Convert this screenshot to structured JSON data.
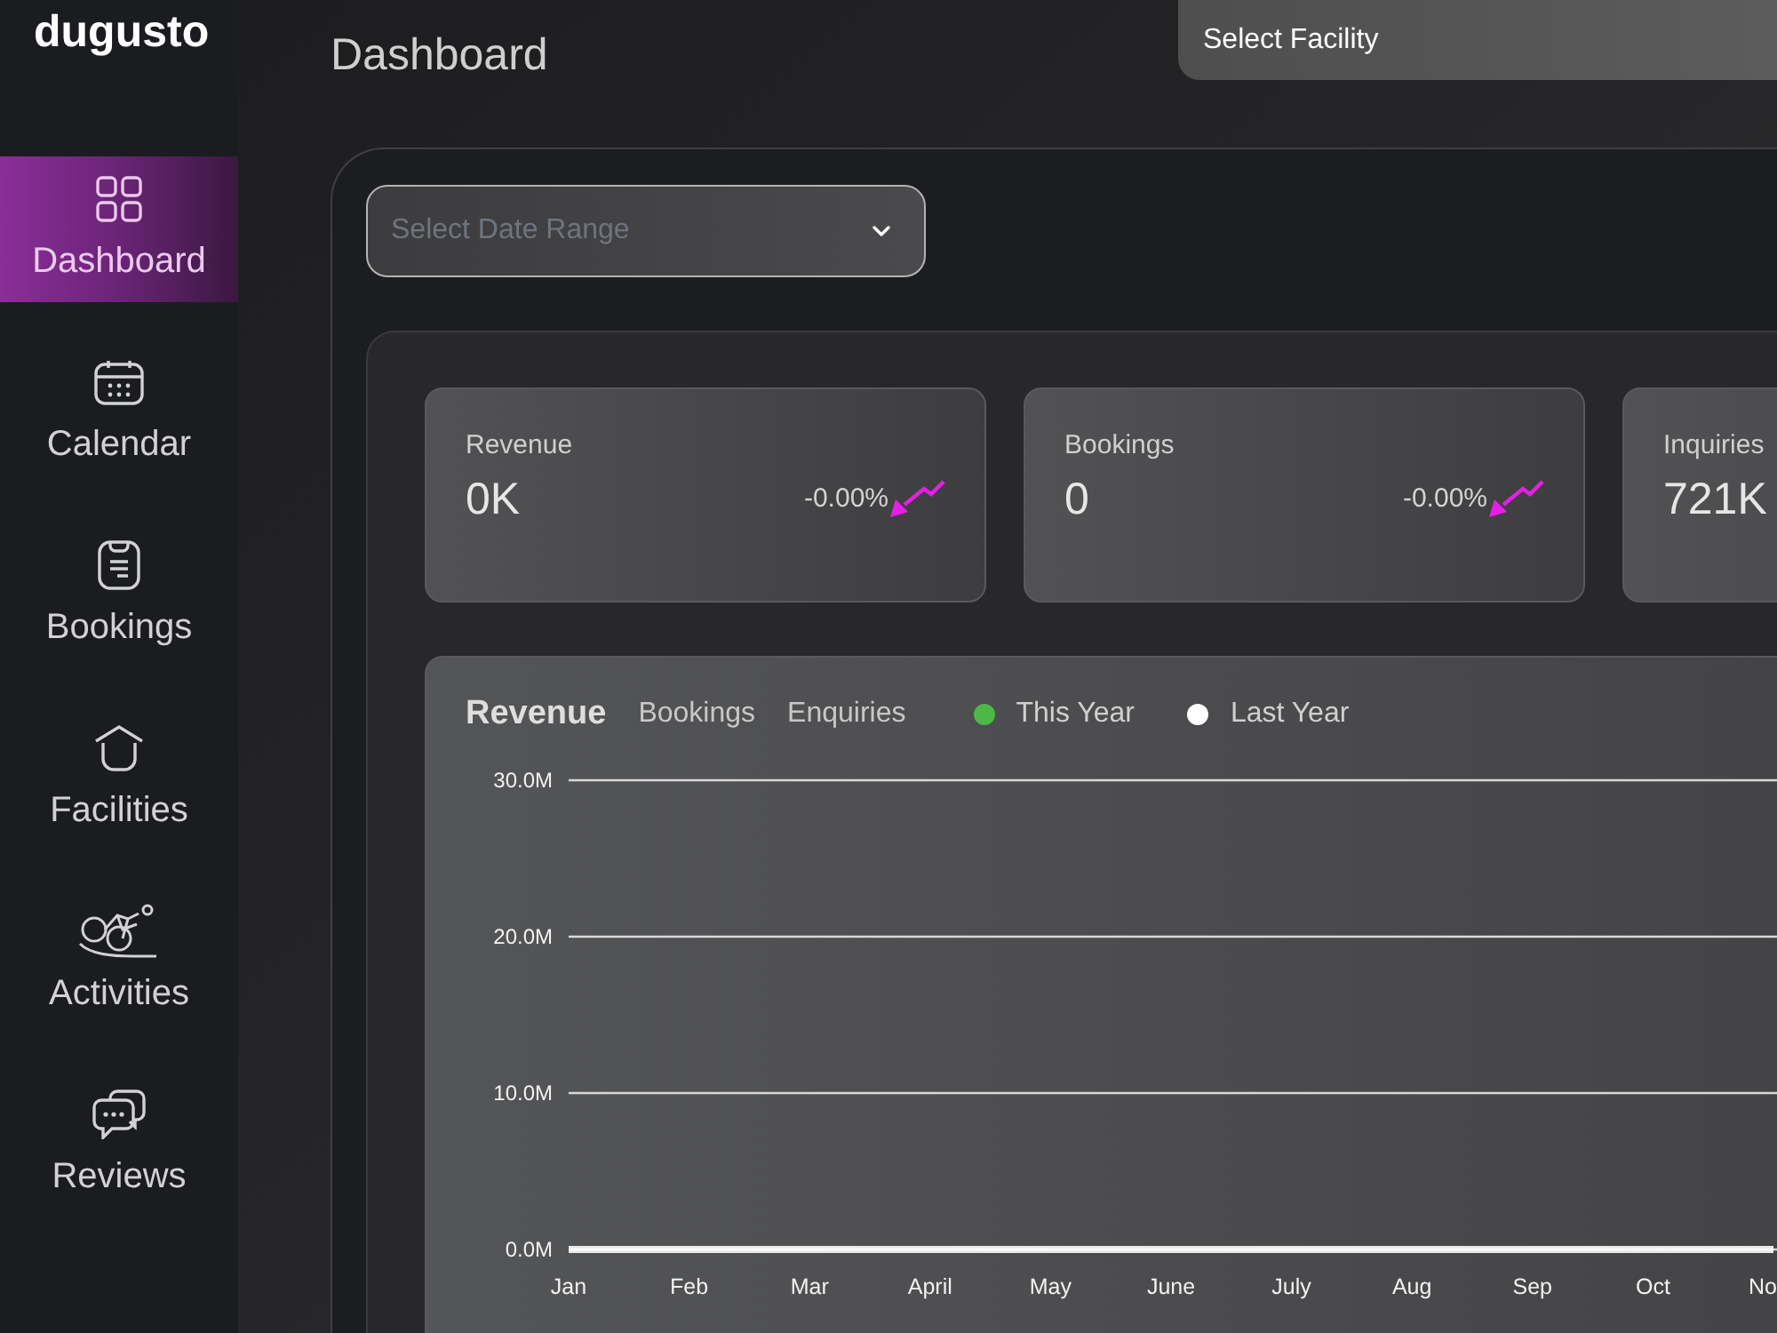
{
  "sidebar": {
    "logo": "dugusto",
    "items": [
      {
        "label": "Dashboard",
        "selected": true
      },
      {
        "label": "Calendar",
        "selected": false
      },
      {
        "label": "Bookings",
        "selected": false
      },
      {
        "label": "Facilities",
        "selected": false
      },
      {
        "label": "Activities",
        "selected": false
      },
      {
        "label": "Reviews",
        "selected": false
      }
    ]
  },
  "header": {
    "title": "Dashboard",
    "facility_select": {
      "placeholder": "Select Facility"
    }
  },
  "date_range_select": {
    "placeholder": "Select Date Range"
  },
  "stat_cards": [
    {
      "label": "Revenue",
      "value": "0K",
      "change": "-0.00%",
      "negative": true
    },
    {
      "label": "Bookings",
      "value": "0",
      "change": "-0.00%",
      "negative": true
    },
    {
      "label": "Inquiries",
      "value": "721K"
    }
  ],
  "chart_panel": {
    "tabs": [
      {
        "label": "Revenue",
        "selected": true
      },
      {
        "label": "Bookings",
        "selected": false
      },
      {
        "label": "Enquiries",
        "selected": false
      }
    ],
    "chart_data": {
      "type": "line",
      "categories": [
        "Jan",
        "Feb",
        "Mar",
        "April",
        "May",
        "June",
        "July",
        "Aug",
        "Sep",
        "Oct",
        "No"
      ],
      "series": [
        {
          "name": "This Year",
          "color": "#4cb848",
          "values": [
            null,
            null,
            null,
            null,
            null,
            null,
            null,
            null,
            null,
            null,
            null
          ]
        },
        {
          "name": "Last Year",
          "color": "#ffffff",
          "values": [
            0,
            0,
            0,
            0,
            0,
            0,
            0,
            0,
            0,
            0,
            0
          ]
        }
      ],
      "ylim": [
        0,
        30
      ],
      "yticks": [
        {
          "value": 0,
          "label": "0.0M"
        },
        {
          "value": 10,
          "label": "10.0M"
        },
        {
          "value": 20,
          "label": "20.0M"
        },
        {
          "value": 30,
          "label": "30.0M"
        }
      ]
    }
  }
}
